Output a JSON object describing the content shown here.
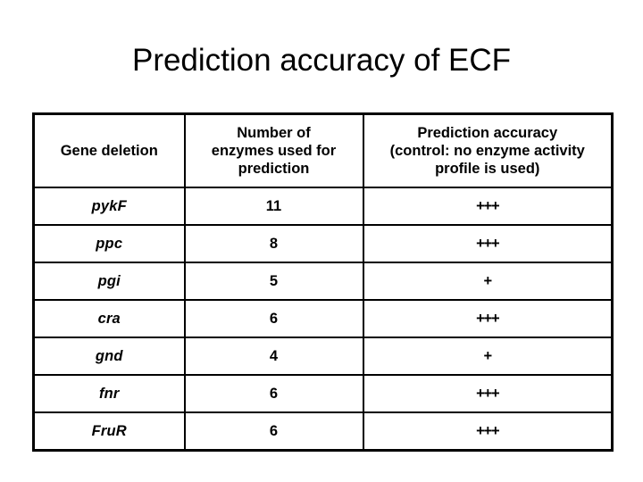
{
  "slide": {
    "title": "Prediction accuracy of ECF",
    "background_color": "#ffffff",
    "text_color": "#000000"
  },
  "table": {
    "headers": [
      {
        "lines": [
          "Gene deletion"
        ]
      },
      {
        "lines": [
          "Number of",
          "enzymes used for",
          "prediction"
        ]
      },
      {
        "lines": [
          "Prediction accuracy",
          "(control: no enzyme activity",
          "profile is used)"
        ]
      }
    ],
    "rows": [
      {
        "gene": "pykF",
        "enzymes": "11",
        "accuracy": "+++"
      },
      {
        "gene": "ppc",
        "enzymes": "8",
        "accuracy": "+++"
      },
      {
        "gene": "pgi",
        "enzymes": "5",
        "accuracy": "+"
      },
      {
        "gene": "cra",
        "enzymes": "6",
        "accuracy": "+++"
      },
      {
        "gene": "gnd",
        "enzymes": "4",
        "accuracy": "+"
      },
      {
        "gene": "fnr",
        "enzymes": "6",
        "accuracy": "+++"
      },
      {
        "gene": "FruR",
        "enzymes": "6",
        "accuracy": "+++"
      }
    ]
  }
}
